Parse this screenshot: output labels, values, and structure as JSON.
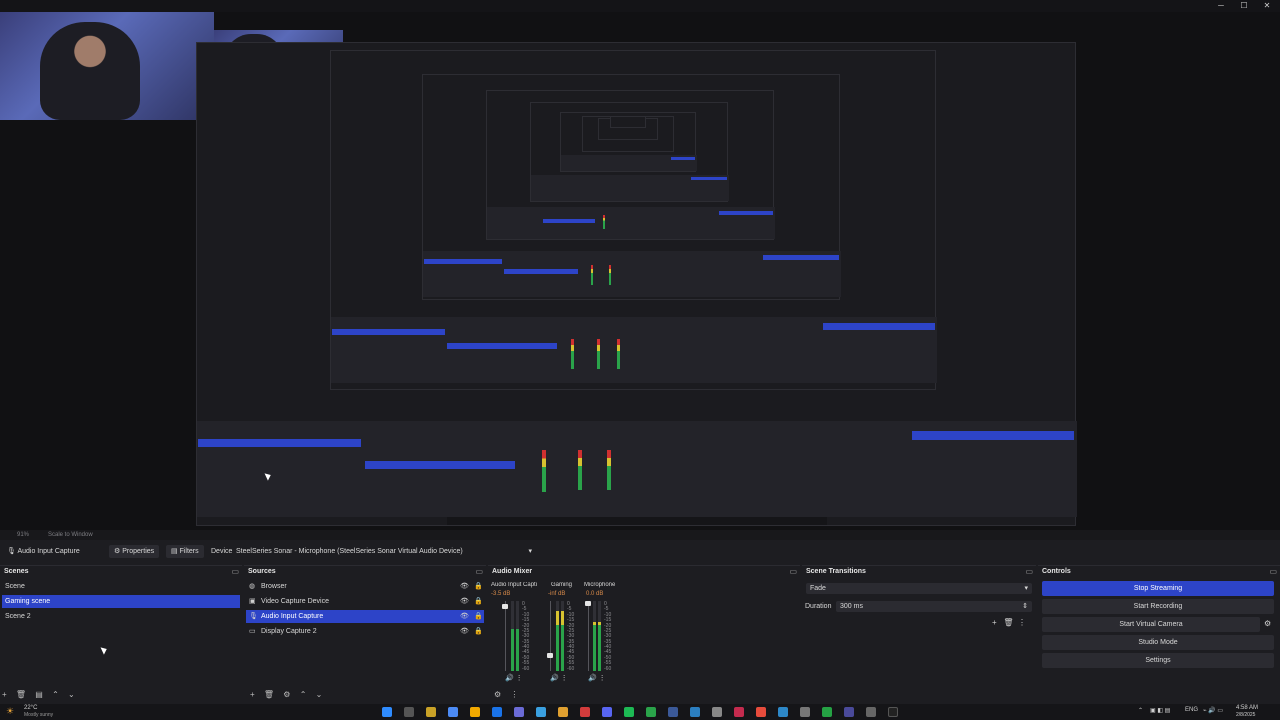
{
  "window": {
    "minimize": "─",
    "maximize": "☐",
    "close": "✕"
  },
  "statusbar": {
    "zoom": "91%",
    "scale": "Scale to Window"
  },
  "propbar": {
    "source_name": "Audio Input Capture",
    "properties_label": "Properties",
    "filters_label": "Filters",
    "device_label": "Device",
    "device_value": "SteelSeries Sonar - Microphone (SteelSeries Sonar Virtual Audio Device)"
  },
  "scenes": {
    "title": "Scenes",
    "items": [
      "Scene",
      "Gaming scene",
      "Scene 2"
    ],
    "selected_index": 1
  },
  "sources": {
    "title": "Sources",
    "items": [
      {
        "label": "Browser",
        "icon": "globe-icon"
      },
      {
        "label": "Video Capture Device",
        "icon": "camera-icon"
      },
      {
        "label": "Audio Input Capture",
        "icon": "microphone-icon"
      },
      {
        "label": "Display Capture 2",
        "icon": "monitor-icon"
      }
    ],
    "selected_index": 2
  },
  "mixer": {
    "title": "Audio Mixer",
    "channels": [
      {
        "name": "Audio Input Captur",
        "db": "-3.5 dB",
        "level": 0.6,
        "volume": 0.95
      },
      {
        "name": "Gaming",
        "db": "-inf dB",
        "level": 0.85,
        "volume": 0.2
      },
      {
        "name": "Microphone",
        "db": "0.0 dB",
        "level": 0.7,
        "volume": 1.0
      }
    ],
    "ticks": [
      "0",
      "-5",
      "-10",
      "-15",
      "-20",
      "-25",
      "-30",
      "-35",
      "-40",
      "-45",
      "-50",
      "-55",
      "-60"
    ]
  },
  "transitions": {
    "title": "Scene Transitions",
    "transition": "Fade",
    "duration_label": "Duration",
    "duration_value": "300 ms"
  },
  "controls": {
    "title": "Controls",
    "buttons": [
      "Stop Streaming",
      "Start Recording",
      "Start Virtual Camera",
      "Studio Mode",
      "Settings"
    ]
  },
  "taskbar": {
    "weather_temp": "22°C",
    "weather_desc": "Mostly sunny",
    "lang": "ENG",
    "time": "4:58 AM",
    "date": "2/8/2025"
  },
  "colors": {
    "accent": "#2d44c8",
    "background": "#1d1d21",
    "panel": "#2b2b31"
  }
}
